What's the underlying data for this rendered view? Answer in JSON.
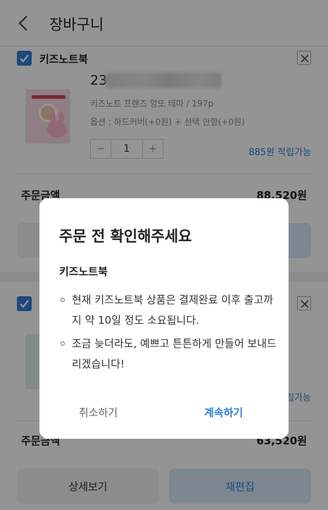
{
  "header": {
    "title": "장바구니"
  },
  "cart_item_1": {
    "shop": "키즈노트북",
    "product_name_prefix": "23",
    "description": "키즈노트 프렌즈 앙또 테마 / 197p",
    "options": "옵션 : 하드커버(+0원) + 선택 안함(+0원)",
    "quantity": "1",
    "points": "885원 적립가능",
    "total_label": "주문금액",
    "total_value": "88,520원"
  },
  "cart_item_2": {
    "points_partial": "립가능",
    "total_label": "주문금액",
    "total_value": "63,520원",
    "detail_button": "상세보기",
    "edit_button": "재편집"
  },
  "dialog": {
    "title": "주문 전 확인해주세요",
    "subtitle": "키즈노트북",
    "items": [
      "현재 키즈노트북 상품은 결제완료 이후 출고까지 약 10일 정도 소요됩니다.",
      "조금 늦더라도, 예쁘고 튼튼하게 만들어 보내드리겠습니다!"
    ],
    "cancel_label": "취소하기",
    "continue_label": "계속하기"
  },
  "colors": {
    "accent": "#2f7fd6",
    "overlay": "rgba(0,0,0,0.42)"
  },
  "icons": [
    "back-arrow-icon",
    "checkbox-checked-icon",
    "close-icon",
    "minus-icon",
    "plus-icon"
  ]
}
